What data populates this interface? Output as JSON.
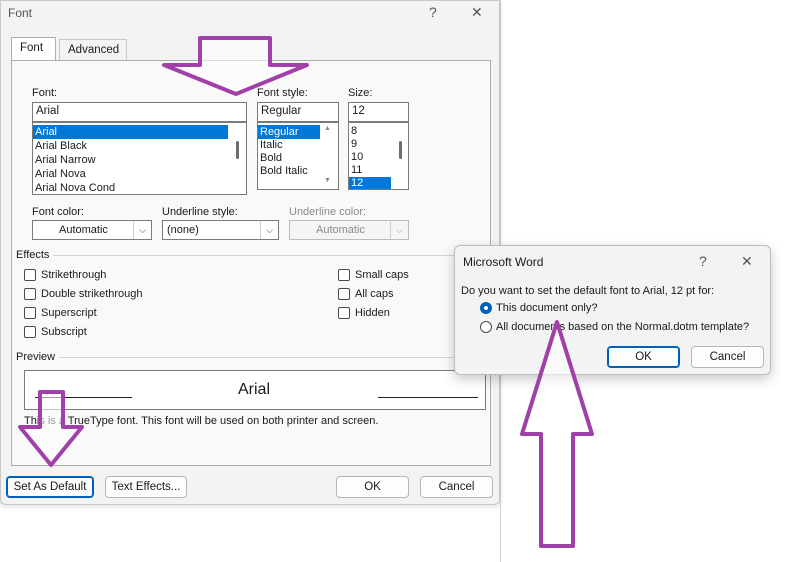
{
  "font_dialog": {
    "title": "Font",
    "help_glyph": "?",
    "close_glyph": "✕",
    "tabs": [
      {
        "label": "Font",
        "active": true
      },
      {
        "label": "Advanced",
        "active": false
      }
    ],
    "font": {
      "label": "Font:",
      "value": "Arial",
      "items": [
        "Arial",
        "Arial Black",
        "Arial Narrow",
        "Arial Nova",
        "Arial Nova Cond"
      ],
      "selected": "Arial"
    },
    "font_style": {
      "label": "Font style:",
      "value": "Regular",
      "items": [
        "Regular",
        "Italic",
        "Bold",
        "Bold Italic"
      ],
      "selected": "Regular"
    },
    "size": {
      "label": "Size:",
      "value": "12",
      "items": [
        "8",
        "9",
        "10",
        "11",
        "12"
      ],
      "selected": "12"
    },
    "font_color": {
      "label": "Font color:",
      "value": "Automatic"
    },
    "underline_style": {
      "label": "Underline style:",
      "value": "(none)"
    },
    "underline_color": {
      "label": "Underline color:",
      "value": "Automatic"
    },
    "effects": {
      "label": "Effects",
      "left": [
        "Strikethrough",
        "Double strikethrough",
        "Superscript",
        "Subscript"
      ],
      "right": [
        "Small caps",
        "All caps",
        "Hidden"
      ]
    },
    "preview": {
      "label": "Preview",
      "sample": "Arial",
      "note": "This is a TrueType font. This font will be used on both printer and screen."
    },
    "buttons": {
      "set_default": "Set As Default",
      "text_effects": "Text Effects...",
      "ok": "OK",
      "cancel": "Cancel"
    }
  },
  "message_dialog": {
    "title": "Microsoft Word",
    "help_glyph": "?",
    "close_glyph": "✕",
    "question": "Do you want to set the default font to Arial, 12 pt for:",
    "options": [
      {
        "label": "This document only?",
        "selected": true
      },
      {
        "label": "All documents based on the Normal.dotm template?",
        "selected": false
      }
    ],
    "buttons": {
      "ok": "OK",
      "cancel": "Cancel"
    }
  },
  "colors": {
    "accent": "#0078d7",
    "arrow_stroke": "#a040a8",
    "arrow_fill": "#ffffff"
  },
  "icons": {
    "combo_arrow": "chevron-down-icon",
    "annotation_arrows": [
      "arrow-down-icon",
      "arrow-up-icon"
    ]
  }
}
